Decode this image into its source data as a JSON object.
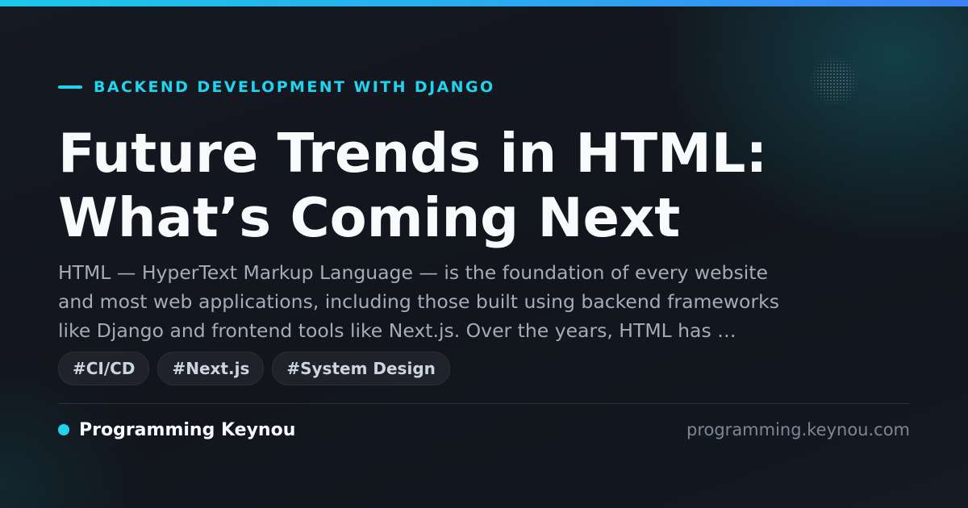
{
  "category": "BACKEND DEVELOPMENT WITH DJANGO",
  "title_lines": [
    "Future Trends in HTML:",
    "What’s Coming Next"
  ],
  "description_lines": [
    "HTML — HyperText Markup Language — is the foundation of every website",
    "and most web applications, including those built using backend frameworks",
    "like Django and frontend tools like Next.js. Over the years, HTML has …"
  ],
  "tags": [
    "#CI/CD",
    "#Next.js",
    "#System Design"
  ],
  "footer": {
    "brand": "Programming Keynou",
    "url": "programming.keynou.com"
  },
  "colors": {
    "accent": "#22d3ee",
    "background": "#12151c",
    "title": "#f8fafc",
    "description": "#a3acb9",
    "muted": "#7d8694"
  }
}
